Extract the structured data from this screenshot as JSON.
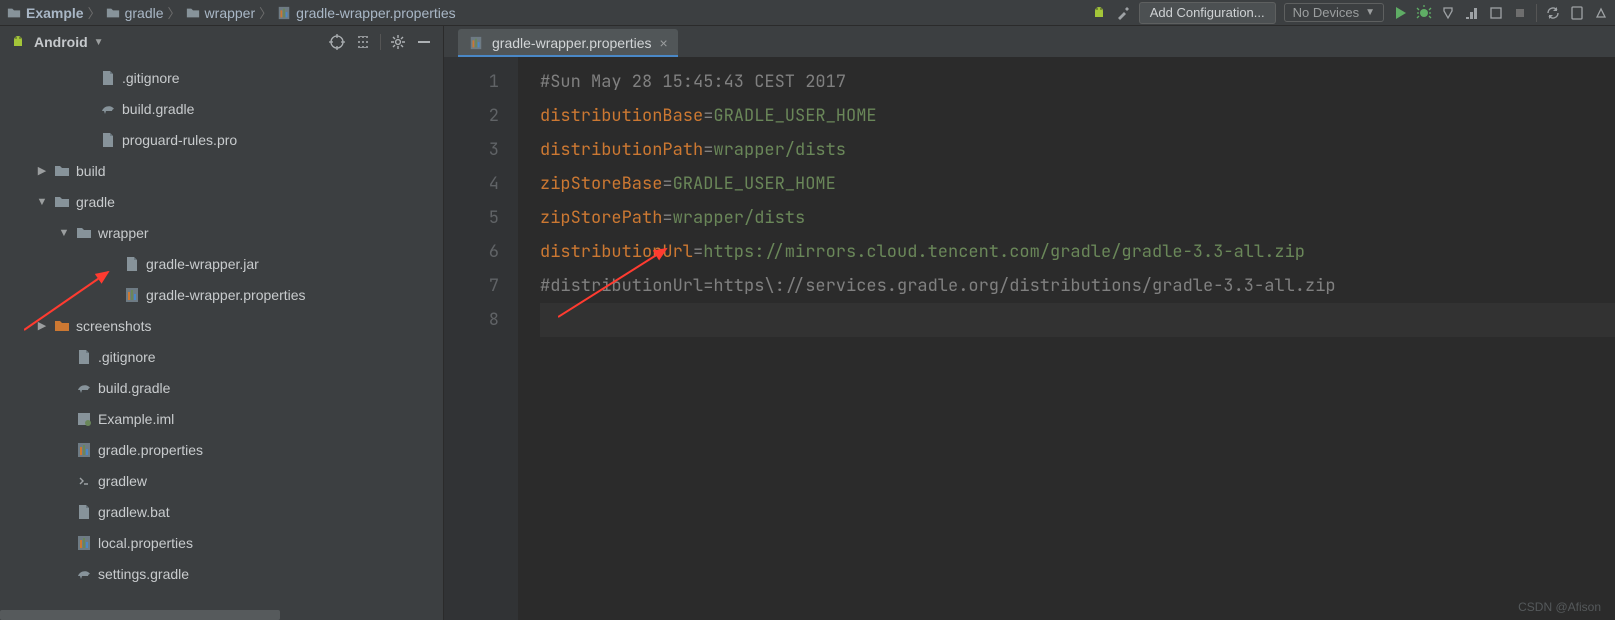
{
  "breadcrumbs": [
    "Example",
    "gradle",
    "wrapper",
    "gradle-wrapper.properties"
  ],
  "toolbar": {
    "add_config": "Add Configuration...",
    "devices": "No Devices"
  },
  "project_panel": {
    "title": "Android",
    "tree": [
      {
        "lvl": 3,
        "kind": "file-generic",
        "label": ".gitignore"
      },
      {
        "lvl": 3,
        "kind": "gradle",
        "label": "build.gradle"
      },
      {
        "lvl": 3,
        "kind": "file-generic",
        "label": "proguard-rules.pro"
      },
      {
        "lvl": 1,
        "kind": "folder",
        "label": "build",
        "arrow": "right"
      },
      {
        "lvl": 1,
        "kind": "folder",
        "label": "gradle",
        "arrow": "down"
      },
      {
        "lvl": 2,
        "kind": "folder",
        "label": "wrapper",
        "arrow": "down"
      },
      {
        "lvl": 4,
        "kind": "file-generic",
        "label": "gradle-wrapper.jar"
      },
      {
        "lvl": 4,
        "kind": "properties",
        "label": "gradle-wrapper.properties"
      },
      {
        "lvl": 1,
        "kind": "folder-orange",
        "label": "screenshots",
        "arrow": "right"
      },
      {
        "lvl": 2,
        "kind": "file-generic",
        "label": ".gitignore"
      },
      {
        "lvl": 2,
        "kind": "gradle",
        "label": "build.gradle"
      },
      {
        "lvl": 2,
        "kind": "module",
        "label": "Example.iml"
      },
      {
        "lvl": 2,
        "kind": "properties",
        "label": "gradle.properties"
      },
      {
        "lvl": 2,
        "kind": "script",
        "label": "gradlew"
      },
      {
        "lvl": 2,
        "kind": "file-generic",
        "label": "gradlew.bat"
      },
      {
        "lvl": 2,
        "kind": "properties",
        "label": "local.properties"
      },
      {
        "lvl": 2,
        "kind": "gradle",
        "label": "settings.gradle"
      }
    ]
  },
  "editor": {
    "tab": {
      "label": "gradle-wrapper.properties"
    },
    "gutter": [
      "1",
      "2",
      "3",
      "4",
      "5",
      "6",
      "7",
      "8"
    ],
    "lines": {
      "l1": "#Sun May 28 15:45:43 CEST 2017",
      "l2k": "distributionBase",
      "l2v": "GRADLE_USER_HOME",
      "l3k": "distributionPath",
      "l3v": "wrapper/dists",
      "l4k": "zipStoreBase",
      "l4v": "GRADLE_USER_HOME",
      "l5k": "zipStorePath",
      "l5v": "wrapper/dists",
      "l6k": "distributionUrl",
      "l6v": "https://mirrors.cloud.tencent.com/gradle/gradle-3.3-all.zip",
      "l7": "#distributionUrl=https\\://services.gradle.org/distributions/gradle-3.3-all.zip"
    }
  },
  "watermark": "CSDN @Afison"
}
